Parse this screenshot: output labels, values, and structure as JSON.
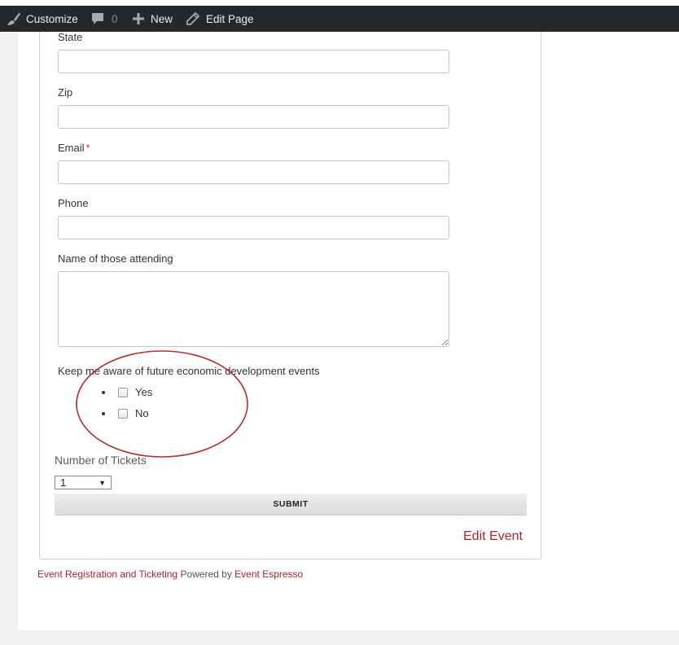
{
  "adminbar": {
    "customize": "Customize",
    "comments_count": "0",
    "new": "New",
    "edit_page": "Edit Page"
  },
  "form": {
    "state_label": "State",
    "zip_label": "Zip",
    "email_label": "Email",
    "email_required_mark": "*",
    "phone_label": "Phone",
    "attending_label": "Name of those attending",
    "keep_aware_label": "Keep me aware of future economic development events",
    "options": [
      "Yes",
      "No"
    ],
    "tickets_label": "Number of Tickets",
    "tickets_value": "1",
    "submit_label": "SUBMIT"
  },
  "edit_event": "Edit Event",
  "footer": {
    "link1": "Event Registration and Ticketing",
    "middle": "Powered by",
    "link2": "Event Espresso"
  },
  "colors": {
    "adminbar_bg": "#23282d",
    "link_red": "#b0222e",
    "required_red": "#c0392b",
    "annotation_circle": "#b03030"
  }
}
